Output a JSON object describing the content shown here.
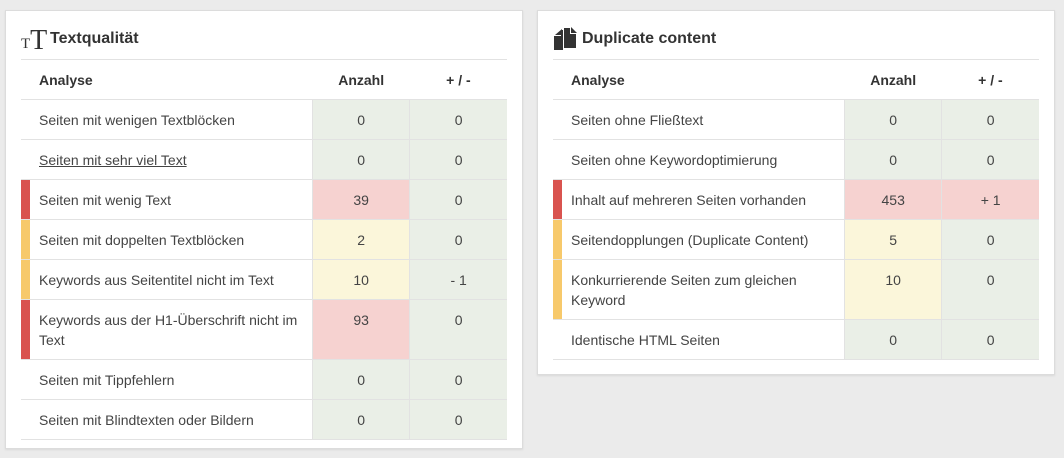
{
  "colors": {
    "red_marker": "#d9534f",
    "yellow_marker": "#f7c96b",
    "green_cell": "#eaefe7",
    "red_cell": "#f6d2d0",
    "yellow_cell": "#fbf6da"
  },
  "left_panel": {
    "icon": "text-size-icon",
    "title": "Textqualität",
    "columns": {
      "name": "Analyse",
      "count": "Anzahl",
      "delta": "+ / -"
    },
    "rows": [
      {
        "name": "Seiten mit wenigen Textblöcken",
        "count": "0",
        "delta": "0",
        "status": "none",
        "link": false
      },
      {
        "name": "Seiten mit sehr viel Text",
        "count": "0",
        "delta": "0",
        "status": "none",
        "link": true
      },
      {
        "name": "Seiten mit wenig Text",
        "count": "39",
        "delta": "0",
        "status": "red",
        "link": false
      },
      {
        "name": "Seiten mit doppelten Textblöcken",
        "count": "2",
        "delta": "0",
        "status": "yellow",
        "link": false
      },
      {
        "name": "Keywords aus Seitentitel nicht im Text",
        "count": "10",
        "delta": "- 1",
        "status": "yellow",
        "link": false
      },
      {
        "name": "Keywords aus der H1-Überschrift nicht im Text",
        "count": "93",
        "delta": "0",
        "status": "red",
        "link": false
      },
      {
        "name": "Seiten mit Tippfehlern",
        "count": "0",
        "delta": "0",
        "status": "none",
        "link": false
      },
      {
        "name": "Seiten mit Blindtexten oder Bildern",
        "count": "0",
        "delta": "0",
        "status": "none",
        "link": false
      }
    ]
  },
  "right_panel": {
    "icon": "copy-icon",
    "title": "Duplicate content",
    "columns": {
      "name": "Analyse",
      "count": "Anzahl",
      "delta": "+ / -"
    },
    "rows": [
      {
        "name": "Seiten ohne Fließtext",
        "count": "0",
        "delta": "0",
        "status": "none",
        "delta_status": "green",
        "link": false
      },
      {
        "name": "Seiten ohne Keywordoptimierung",
        "count": "0",
        "delta": "0",
        "status": "none",
        "delta_status": "green",
        "link": false
      },
      {
        "name": "Inhalt auf mehreren Seiten vorhanden",
        "count": "453",
        "delta": "+ 1",
        "status": "red",
        "delta_status": "red",
        "link": false
      },
      {
        "name": "Seitendopplungen (Duplicate Content)",
        "count": "5",
        "delta": "0",
        "status": "yellow",
        "delta_status": "green",
        "link": false
      },
      {
        "name": "Konkurrierende Seiten zum gleichen Keyword",
        "count": "10",
        "delta": "0",
        "status": "yellow",
        "delta_status": "green",
        "link": false
      },
      {
        "name": "Identische HTML Seiten",
        "count": "0",
        "delta": "0",
        "status": "none",
        "delta_status": "green",
        "link": false
      }
    ]
  }
}
